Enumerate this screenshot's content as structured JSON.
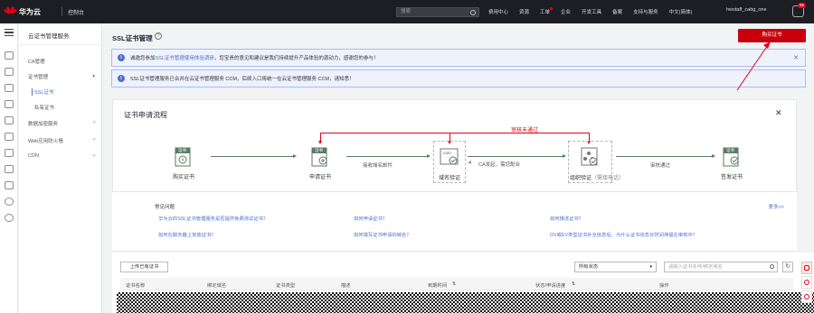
{
  "topbar": {
    "logo_text": "华为云",
    "console": "控制台",
    "search_placeholder": "搜索",
    "nav": [
      "费用中心",
      "资源",
      "工单",
      "企业",
      "开发工具",
      "备案",
      "支持与服务",
      "中文(简体)"
    ],
    "user": "hwstaff_cabg_one",
    "badge": "65"
  },
  "sidenav": {
    "title": "云证书管理服务",
    "items": [
      {
        "label": "CA管理"
      },
      {
        "label": "证书管理"
      },
      {
        "label": "SSL证书"
      },
      {
        "label": "私有证书"
      },
      {
        "label": "数据加密服务"
      },
      {
        "label": "Web应用防火墙"
      },
      {
        "label": "CDN"
      }
    ]
  },
  "main": {
    "title": "SSL证书管理",
    "buy_button": "购买证书",
    "notice1_pre": "诚邀您参加",
    "notice1_link": "SSL证书管理使用体验调研",
    "notice1_post": "，您宝贵的意见和建议是我们持续提升产品体验的源动力，感谢您的参与！",
    "notice2": "SSL证书管理服务已合并在云证书管理服务 CCM，后续入口将统一在云证书管理服务 CCM，请知悉！"
  },
  "flow": {
    "title": "证书申请流程",
    "steps": {
      "buy": "购买证书",
      "apply": "申请证书",
      "domain": "域名验证",
      "org": "组织验证",
      "org_note": "（需接电话）",
      "issue": "签发证书"
    },
    "mid": {
      "recv_email": "接收域名邮件",
      "ca_call": "CA发起，需您配合",
      "review_pass": "审核通过",
      "review_fail": "审核未通过"
    },
    "icon_text": {
      "cert": "证书",
      "com": ".com"
    }
  },
  "faq": {
    "title": "常见问题",
    "more": "更多>>",
    "links": [
      "华为云的SSL证书管理服务是否提供免费测试证书？",
      "如何申请证书？",
      "如何推送证书？",
      "如何在服务器上安装证书？",
      "如何填写证书申请的域名？",
      "OV或EV类型证书补全信息后，为什么证书状态长时间停留在审核中？"
    ]
  },
  "table": {
    "upload_button": "上传已有证书",
    "status_select": "所有状态",
    "search_placeholder": "请输入证书名称/绑定域名",
    "columns": [
      "证书名称",
      "绑定域名",
      "证书类型",
      "描述",
      "到期时间",
      "状态/申请进度",
      "操作"
    ]
  },
  "colors": {
    "accent": "#526ecc",
    "brand_red": "#c7000b",
    "flow_green": "#5a7a66"
  }
}
